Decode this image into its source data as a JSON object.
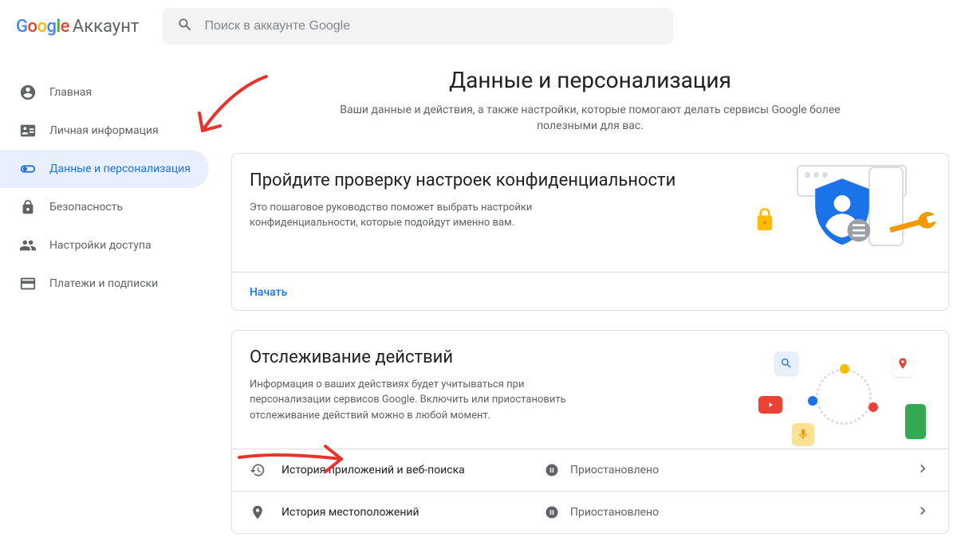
{
  "header": {
    "brand_account": "Аккаунт",
    "search_placeholder": "Поиск в аккаунте Google"
  },
  "sidebar": {
    "items": [
      {
        "id": "home",
        "label": "Главная"
      },
      {
        "id": "personal",
        "label": "Личная информация"
      },
      {
        "id": "data",
        "label": "Данные и персонализация"
      },
      {
        "id": "security",
        "label": "Безопасность"
      },
      {
        "id": "sharing",
        "label": "Настройки доступа"
      },
      {
        "id": "payments",
        "label": "Платежи и подписки"
      }
    ],
    "active_id": "data"
  },
  "main": {
    "title": "Данные и персонализация",
    "subtitle": "Ваши данные и действия, а также настройки, которые помогают делать сервисы Google более полезными для вас."
  },
  "privacy_card": {
    "title": "Пройдите проверку настроек конфиденциальности",
    "desc": "Это пошаговое руководство поможет выбрать настройки конфиденциальности, которые подойдут именно вам.",
    "action": "Начать"
  },
  "activity_card": {
    "title": "Отслеживание действий",
    "desc": "Информация о ваших действиях будет учитываться при персонализации сервисов Google. Включить или приостановить отслеживание действий можно в любой момент.",
    "rows": [
      {
        "id": "web",
        "label": "История приложений и веб-поиска",
        "status": "Приостановлено"
      },
      {
        "id": "location",
        "label": "История местоположений",
        "status": "Приостановлено"
      }
    ]
  }
}
